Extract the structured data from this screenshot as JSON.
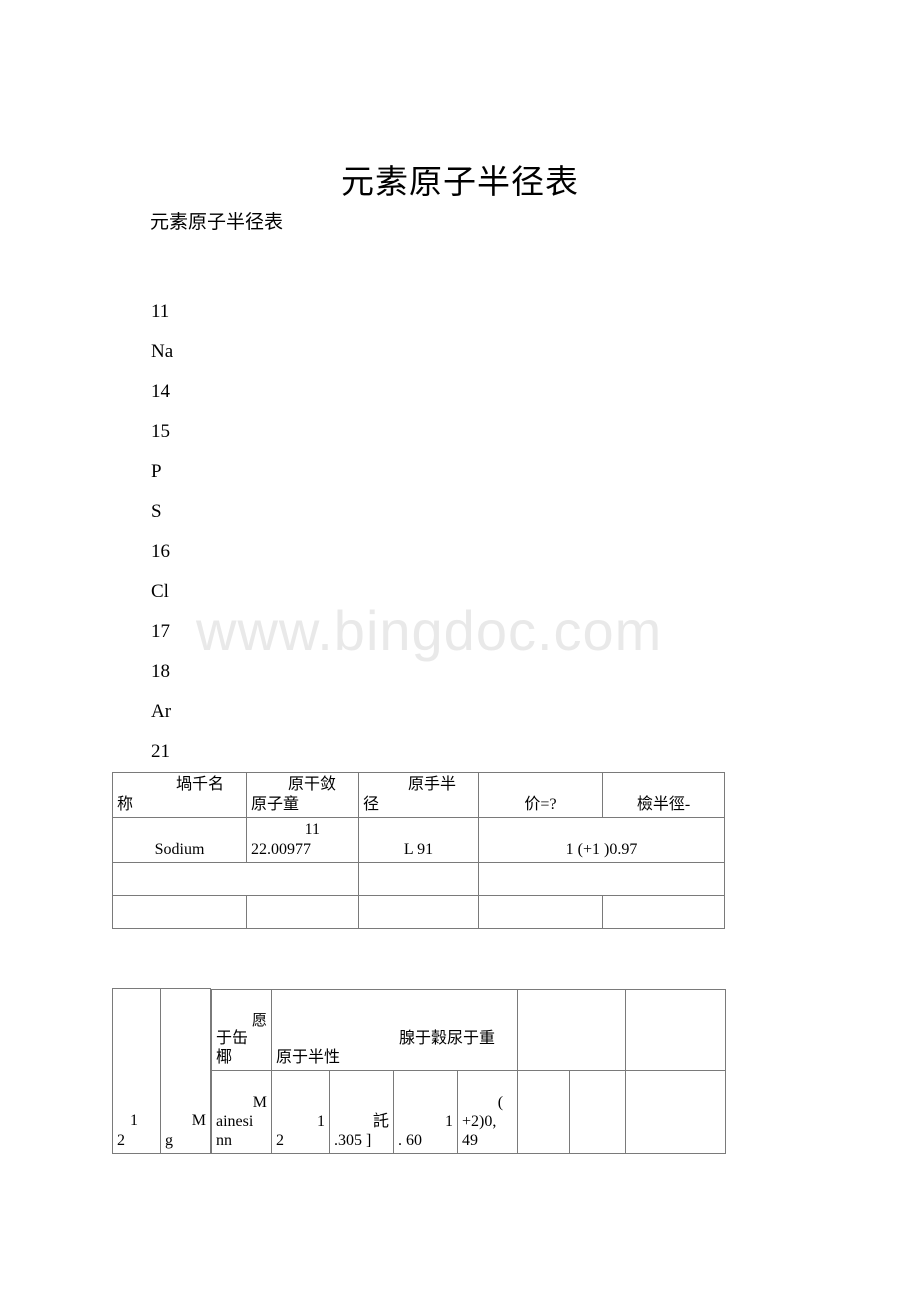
{
  "document": {
    "title": "元素原子半径表",
    "subtitle": "元素原子半径表"
  },
  "watermark": {
    "text": "www.bingdoc.com",
    "color": "#e9e9e9"
  },
  "element_list": [
    {
      "value": "11"
    },
    {
      "value": "Na"
    },
    {
      "value": "14"
    },
    {
      "value": "15"
    },
    {
      "value": "P"
    },
    {
      "value": "S"
    },
    {
      "value": "16"
    },
    {
      "value": "Cl"
    },
    {
      "value": "17"
    },
    {
      "value": "18"
    },
    {
      "value": "Ar"
    },
    {
      "value": "21"
    }
  ],
  "table_one": {
    "header": {
      "col1_top": "堝千名",
      "col1_bottom": "称",
      "col2_top": "原干敛",
      "col2_bottom": "原子童",
      "col3_top": "原手半",
      "col3_bottom": "径",
      "col4": "价=?",
      "col5": "檢半徑-"
    },
    "row_sodium": {
      "name": "Sodium",
      "atomic_number": "11",
      "atomic_mass": "22.00977",
      "radius": "L 91",
      "valence_radius": "1 (+1 )0.97",
      "last": ""
    },
    "blank_row_a": [
      "",
      "",
      ""
    ],
    "blank_row_b": [
      "",
      "",
      "",
      "",
      ""
    ]
  },
  "table_two": {
    "col_left": "2",
    "col_period_top": "1",
    "col_symbol_bottom": "g",
    "col_symbol_top": "M",
    "header": {
      "label_sup": "愿",
      "label_mid_top": "于缶",
      "label_mid_bottom": "椰",
      "wide_top": "腺于穀尿于重",
      "wide_bottom": "原于半性"
    },
    "body": {
      "name_top": "M",
      "name_mid": "ainesi",
      "name_bottom": "nn",
      "num_top": "1",
      "num_bottom": "2",
      "mass_top": "託",
      "mass_bottom": ".305 ]",
      "radius_top": "1",
      "radius_bottom": ". 60",
      "ion_top": "(",
      "ion_mid": "+2)0,",
      "ion_bottom": "49"
    }
  }
}
